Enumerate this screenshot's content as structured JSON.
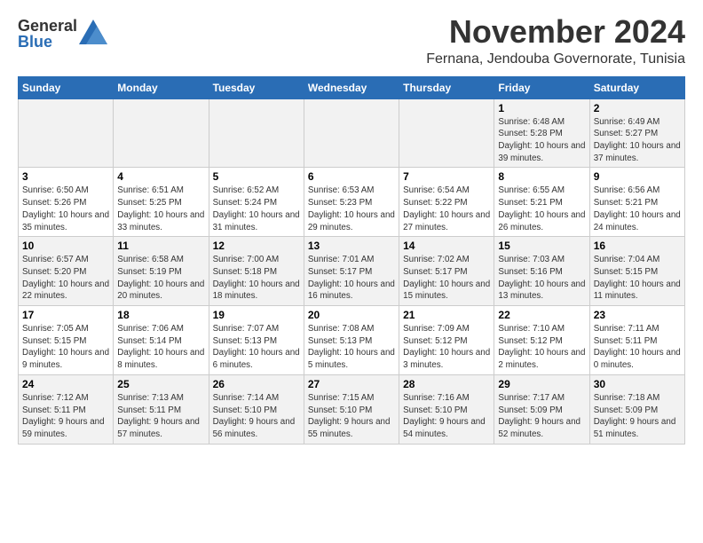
{
  "logo": {
    "general": "General",
    "blue": "Blue"
  },
  "header": {
    "month": "November 2024",
    "location": "Fernana, Jendouba Governorate, Tunisia"
  },
  "weekdays": [
    "Sunday",
    "Monday",
    "Tuesday",
    "Wednesday",
    "Thursday",
    "Friday",
    "Saturday"
  ],
  "weeks": [
    [
      {
        "day": "",
        "info": ""
      },
      {
        "day": "",
        "info": ""
      },
      {
        "day": "",
        "info": ""
      },
      {
        "day": "",
        "info": ""
      },
      {
        "day": "",
        "info": ""
      },
      {
        "day": "1",
        "info": "Sunrise: 6:48 AM\nSunset: 5:28 PM\nDaylight: 10 hours and 39 minutes."
      },
      {
        "day": "2",
        "info": "Sunrise: 6:49 AM\nSunset: 5:27 PM\nDaylight: 10 hours and 37 minutes."
      }
    ],
    [
      {
        "day": "3",
        "info": "Sunrise: 6:50 AM\nSunset: 5:26 PM\nDaylight: 10 hours and 35 minutes."
      },
      {
        "day": "4",
        "info": "Sunrise: 6:51 AM\nSunset: 5:25 PM\nDaylight: 10 hours and 33 minutes."
      },
      {
        "day": "5",
        "info": "Sunrise: 6:52 AM\nSunset: 5:24 PM\nDaylight: 10 hours and 31 minutes."
      },
      {
        "day": "6",
        "info": "Sunrise: 6:53 AM\nSunset: 5:23 PM\nDaylight: 10 hours and 29 minutes."
      },
      {
        "day": "7",
        "info": "Sunrise: 6:54 AM\nSunset: 5:22 PM\nDaylight: 10 hours and 27 minutes."
      },
      {
        "day": "8",
        "info": "Sunrise: 6:55 AM\nSunset: 5:21 PM\nDaylight: 10 hours and 26 minutes."
      },
      {
        "day": "9",
        "info": "Sunrise: 6:56 AM\nSunset: 5:21 PM\nDaylight: 10 hours and 24 minutes."
      }
    ],
    [
      {
        "day": "10",
        "info": "Sunrise: 6:57 AM\nSunset: 5:20 PM\nDaylight: 10 hours and 22 minutes."
      },
      {
        "day": "11",
        "info": "Sunrise: 6:58 AM\nSunset: 5:19 PM\nDaylight: 10 hours and 20 minutes."
      },
      {
        "day": "12",
        "info": "Sunrise: 7:00 AM\nSunset: 5:18 PM\nDaylight: 10 hours and 18 minutes."
      },
      {
        "day": "13",
        "info": "Sunrise: 7:01 AM\nSunset: 5:17 PM\nDaylight: 10 hours and 16 minutes."
      },
      {
        "day": "14",
        "info": "Sunrise: 7:02 AM\nSunset: 5:17 PM\nDaylight: 10 hours and 15 minutes."
      },
      {
        "day": "15",
        "info": "Sunrise: 7:03 AM\nSunset: 5:16 PM\nDaylight: 10 hours and 13 minutes."
      },
      {
        "day": "16",
        "info": "Sunrise: 7:04 AM\nSunset: 5:15 PM\nDaylight: 10 hours and 11 minutes."
      }
    ],
    [
      {
        "day": "17",
        "info": "Sunrise: 7:05 AM\nSunset: 5:15 PM\nDaylight: 10 hours and 9 minutes."
      },
      {
        "day": "18",
        "info": "Sunrise: 7:06 AM\nSunset: 5:14 PM\nDaylight: 10 hours and 8 minutes."
      },
      {
        "day": "19",
        "info": "Sunrise: 7:07 AM\nSunset: 5:13 PM\nDaylight: 10 hours and 6 minutes."
      },
      {
        "day": "20",
        "info": "Sunrise: 7:08 AM\nSunset: 5:13 PM\nDaylight: 10 hours and 5 minutes."
      },
      {
        "day": "21",
        "info": "Sunrise: 7:09 AM\nSunset: 5:12 PM\nDaylight: 10 hours and 3 minutes."
      },
      {
        "day": "22",
        "info": "Sunrise: 7:10 AM\nSunset: 5:12 PM\nDaylight: 10 hours and 2 minutes."
      },
      {
        "day": "23",
        "info": "Sunrise: 7:11 AM\nSunset: 5:11 PM\nDaylight: 10 hours and 0 minutes."
      }
    ],
    [
      {
        "day": "24",
        "info": "Sunrise: 7:12 AM\nSunset: 5:11 PM\nDaylight: 9 hours and 59 minutes."
      },
      {
        "day": "25",
        "info": "Sunrise: 7:13 AM\nSunset: 5:11 PM\nDaylight: 9 hours and 57 minutes."
      },
      {
        "day": "26",
        "info": "Sunrise: 7:14 AM\nSunset: 5:10 PM\nDaylight: 9 hours and 56 minutes."
      },
      {
        "day": "27",
        "info": "Sunrise: 7:15 AM\nSunset: 5:10 PM\nDaylight: 9 hours and 55 minutes."
      },
      {
        "day": "28",
        "info": "Sunrise: 7:16 AM\nSunset: 5:10 PM\nDaylight: 9 hours and 54 minutes."
      },
      {
        "day": "29",
        "info": "Sunrise: 7:17 AM\nSunset: 5:09 PM\nDaylight: 9 hours and 52 minutes."
      },
      {
        "day": "30",
        "info": "Sunrise: 7:18 AM\nSunset: 5:09 PM\nDaylight: 9 hours and 51 minutes."
      }
    ]
  ]
}
